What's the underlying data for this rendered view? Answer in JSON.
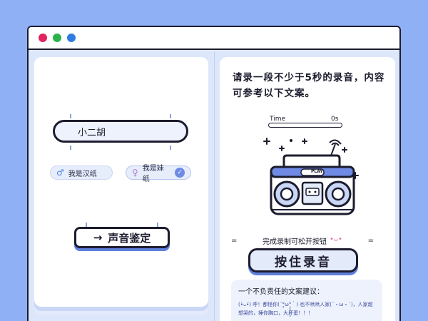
{
  "window": {
    "dots": [
      "#e0245e",
      "#2bb24c",
      "#2f7de1"
    ]
  },
  "left": {
    "name_input": {
      "value": "小二胡"
    },
    "gender_male": {
      "symbol": "♂",
      "label": "我是汉纸"
    },
    "gender_female": {
      "symbol": "♀",
      "label": "我是妹纸",
      "selected": true
    },
    "identify_button": {
      "arrow": "→",
      "label": "声音鉴定"
    }
  },
  "right": {
    "instruction": "请录一段不少于5秒的录音，内容可参考以下文案。",
    "timer": {
      "label": "Time",
      "value": "0s",
      "progress": 0
    },
    "cassette": {
      "label": "PLAY"
    },
    "hint": {
      "left_mark": "=",
      "text": "完成录制可松开按钮",
      "kaomoji": "•ᴗ•",
      "right_mark": "="
    },
    "record_button": {
      "label": "按住录音"
    },
    "suggestion": {
      "title": "一个不负责任的文案建议：",
      "text": "(•̀ᴗ•́) 呼！都怪你(´°̥̥̥̥̥̥̥̥ω°̥̥̥̥̥̥̥̥｀) 也不哄哄人家(´・ω・`)，人家超想哭的，捶你胸口，大坏蛋！！！"
    }
  }
}
